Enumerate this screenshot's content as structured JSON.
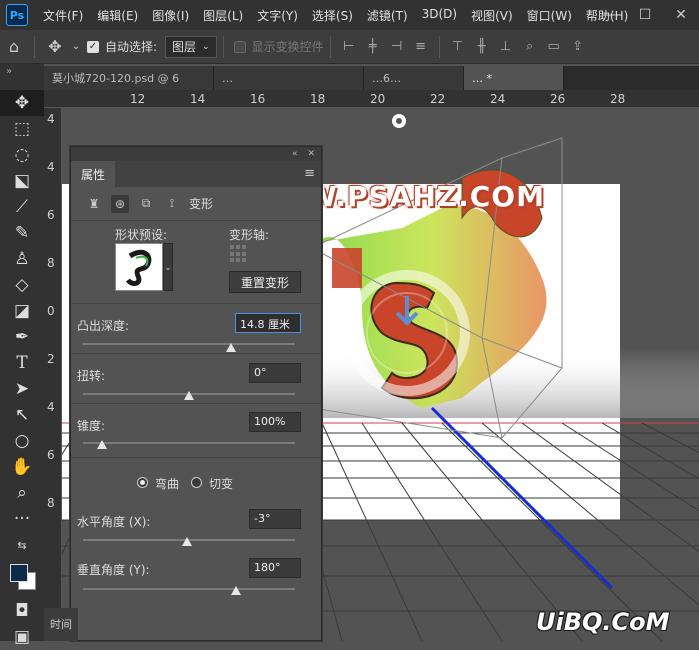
{
  "app": {
    "logo_text": "Ps"
  },
  "menu": [
    "文件(F)",
    "编辑(E)",
    "图像(I)",
    "图层(L)",
    "文字(Y)",
    "选择(S)",
    "滤镜(T)",
    "3D(D)",
    "视图(V)",
    "窗口(W)",
    "帮助(H)"
  ],
  "window_controls": {
    "minimize": "—",
    "maximize": "☐",
    "close": "✕"
  },
  "options_bar": {
    "auto_select_label": "自动选择:",
    "auto_select_checked": true,
    "target_value": "图层",
    "show_transform_label": "显示变换控件",
    "show_transform_checked": false
  },
  "tabs": [
    {
      "label": "莫小城720-120.psd @ 6",
      "active": false
    },
    {
      "label": "…",
      "active": false
    },
    {
      "label": "…6…",
      "active": false
    },
    {
      "label": "… *",
      "active": true
    }
  ],
  "toolbar_head": "»",
  "ruler": {
    "top_labels": [
      "12",
      "14",
      "16",
      "18",
      "20",
      "22",
      "24",
      "26",
      "28"
    ],
    "left_labels": [
      "4",
      "4",
      "6",
      "8",
      "0",
      "2",
      "4",
      "6",
      "8"
    ]
  },
  "properties": {
    "title": "属性",
    "mode_label": "变形",
    "shape_preset_label": "形状预设:",
    "transform_axis_label": "变形轴:",
    "reset_button": "重置变形",
    "extrude_depth_label": "凸出深度:",
    "extrude_depth_value": "14.8 厘米",
    "extrude_depth_percent": 0.7,
    "twist_label": "扭转:",
    "twist_value": "0°",
    "twist_percent": 0.5,
    "taper_label": "锥度:",
    "taper_value": "100%",
    "taper_percent": 0.09,
    "bend_label": "弯曲",
    "shear_label": "切变",
    "bend_selected": true,
    "horizontal_angle_label": "水平角度 (X):",
    "horizontal_angle_value": "-3°",
    "horizontal_angle_percent": 0.49,
    "vertical_angle_label": "垂直角度 (Y):",
    "vertical_angle_value": "180°",
    "vertical_angle_percent": 0.72
  },
  "bottom_tab": "时间",
  "watermarks": {
    "top": "WWW.PSAHZ.COM",
    "bottom": "UiBQ.CoM"
  },
  "colors": {
    "foreground": "#0f2a47",
    "background": "#ffffff",
    "accent": "#4a90e2"
  }
}
